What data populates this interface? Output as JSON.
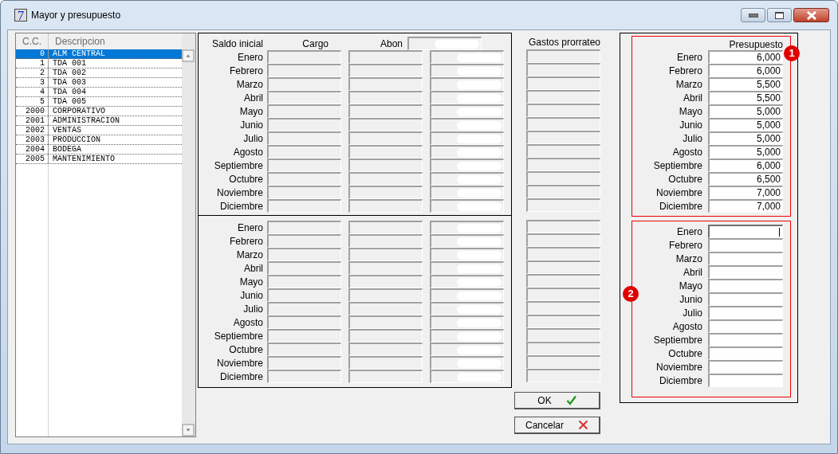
{
  "window": {
    "title": "Mayor y presupuesto",
    "app_icon_glyph": "7"
  },
  "cost_centers": {
    "columns": [
      "C.C.",
      "Descripcion"
    ],
    "rows": [
      {
        "cc": "0",
        "description": "ALM CENTRAL",
        "selected": true
      },
      {
        "cc": "1",
        "description": "TDA 001",
        "selected": false
      },
      {
        "cc": "2",
        "description": "TDA 002",
        "selected": false
      },
      {
        "cc": "3",
        "description": "TDA 003",
        "selected": false
      },
      {
        "cc": "4",
        "description": "TDA 004",
        "selected": false
      },
      {
        "cc": "5",
        "description": "TDA 005",
        "selected": false
      },
      {
        "cc": "2000",
        "description": "CORPORATIVO",
        "selected": false
      },
      {
        "cc": "2001",
        "description": "ADMINISTRACION",
        "selected": false
      },
      {
        "cc": "2002",
        "description": "VENTAS",
        "selected": false
      },
      {
        "cc": "2003",
        "description": "PRODUCCION",
        "selected": false
      },
      {
        "cc": "2004",
        "description": "BODEGA",
        "selected": false
      },
      {
        "cc": "2005",
        "description": "MANTENIMIENTO",
        "selected": false
      }
    ]
  },
  "movements": {
    "opening_label": "Saldo inicial",
    "cargo_header": "Cargo",
    "abon_header": "Abon",
    "opening_abon_redacted": true,
    "sections": [
      {
        "months": [
          {
            "label": "Enero",
            "abon_redacted": true
          },
          {
            "label": "Febrero",
            "abon_redacted": true
          },
          {
            "label": "Marzo",
            "abon_redacted": true
          },
          {
            "label": "Abril",
            "abon_redacted": true
          },
          {
            "label": "Mayo",
            "abon_redacted": true
          },
          {
            "label": "Junio",
            "abon_redacted": true
          },
          {
            "label": "Julio",
            "abon_redacted": true
          },
          {
            "label": "Agosto",
            "abon_redacted": true
          },
          {
            "label": "Septiembre",
            "abon_redacted": true
          },
          {
            "label": "Octubre",
            "abon_redacted": true
          },
          {
            "label": "Noviembre",
            "abon_redacted": true
          },
          {
            "label": "Diciembre",
            "abon_redacted": true
          }
        ]
      },
      {
        "months": [
          {
            "label": "Enero",
            "abon_redacted": true
          },
          {
            "label": "Febrero",
            "abon_redacted": true
          },
          {
            "label": "Marzo",
            "abon_redacted": true
          },
          {
            "label": "Abril",
            "abon_redacted": true
          },
          {
            "label": "Mayo",
            "abon_redacted": true
          },
          {
            "label": "Junio",
            "abon_redacted": true
          },
          {
            "label": "Julio",
            "abon_redacted": true
          },
          {
            "label": "Agosto",
            "abon_redacted": true
          },
          {
            "label": "Septiembre",
            "abon_redacted": true
          },
          {
            "label": "Octubre",
            "abon_redacted": true
          },
          {
            "label": "Noviembre",
            "abon_redacted": true
          },
          {
            "label": "Diciembre",
            "abon_redacted": true
          }
        ]
      }
    ]
  },
  "gastos": {
    "header": "Gastos prorrateo"
  },
  "buttons": [
    {
      "label": "OK",
      "kind": "ok"
    },
    {
      "label": "Cancelar",
      "kind": "cancel"
    }
  ],
  "budget": {
    "sections": [
      {
        "header": "Presupuesto",
        "marker": "1",
        "months": [
          {
            "label": "Enero",
            "value": "6,000",
            "focused": false
          },
          {
            "label": "Febrero",
            "value": "6,000",
            "focused": false
          },
          {
            "label": "Marzo",
            "value": "5,500",
            "focused": false
          },
          {
            "label": "Abril",
            "value": "5,500",
            "focused": false
          },
          {
            "label": "Mayo",
            "value": "5,000",
            "focused": false
          },
          {
            "label": "Junio",
            "value": "5,000",
            "focused": false
          },
          {
            "label": "Julio",
            "value": "5,000",
            "focused": false
          },
          {
            "label": "Agosto",
            "value": "5,000",
            "focused": false
          },
          {
            "label": "Septiembre",
            "value": "6,000",
            "focused": false
          },
          {
            "label": "Octubre",
            "value": "6,500",
            "focused": false
          },
          {
            "label": "Noviembre",
            "value": "7,000",
            "focused": false
          },
          {
            "label": "Diciembre",
            "value": "7,000",
            "focused": false
          }
        ]
      },
      {
        "marker": "2",
        "months": [
          {
            "label": "Enero",
            "focused": true
          },
          {
            "label": "Febrero",
            "focused": false
          },
          {
            "label": "Marzo",
            "focused": false
          },
          {
            "label": "Abril",
            "focused": false
          },
          {
            "label": "Mayo",
            "focused": false
          },
          {
            "label": "Junio",
            "focused": false
          },
          {
            "label": "Julio",
            "focused": false
          },
          {
            "label": "Agosto",
            "focused": false
          },
          {
            "label": "Septiembre",
            "focused": false
          },
          {
            "label": "Octubre",
            "focused": false
          },
          {
            "label": "Noviembre",
            "focused": false
          },
          {
            "label": "Diciembre",
            "focused": false
          }
        ]
      }
    ]
  }
}
